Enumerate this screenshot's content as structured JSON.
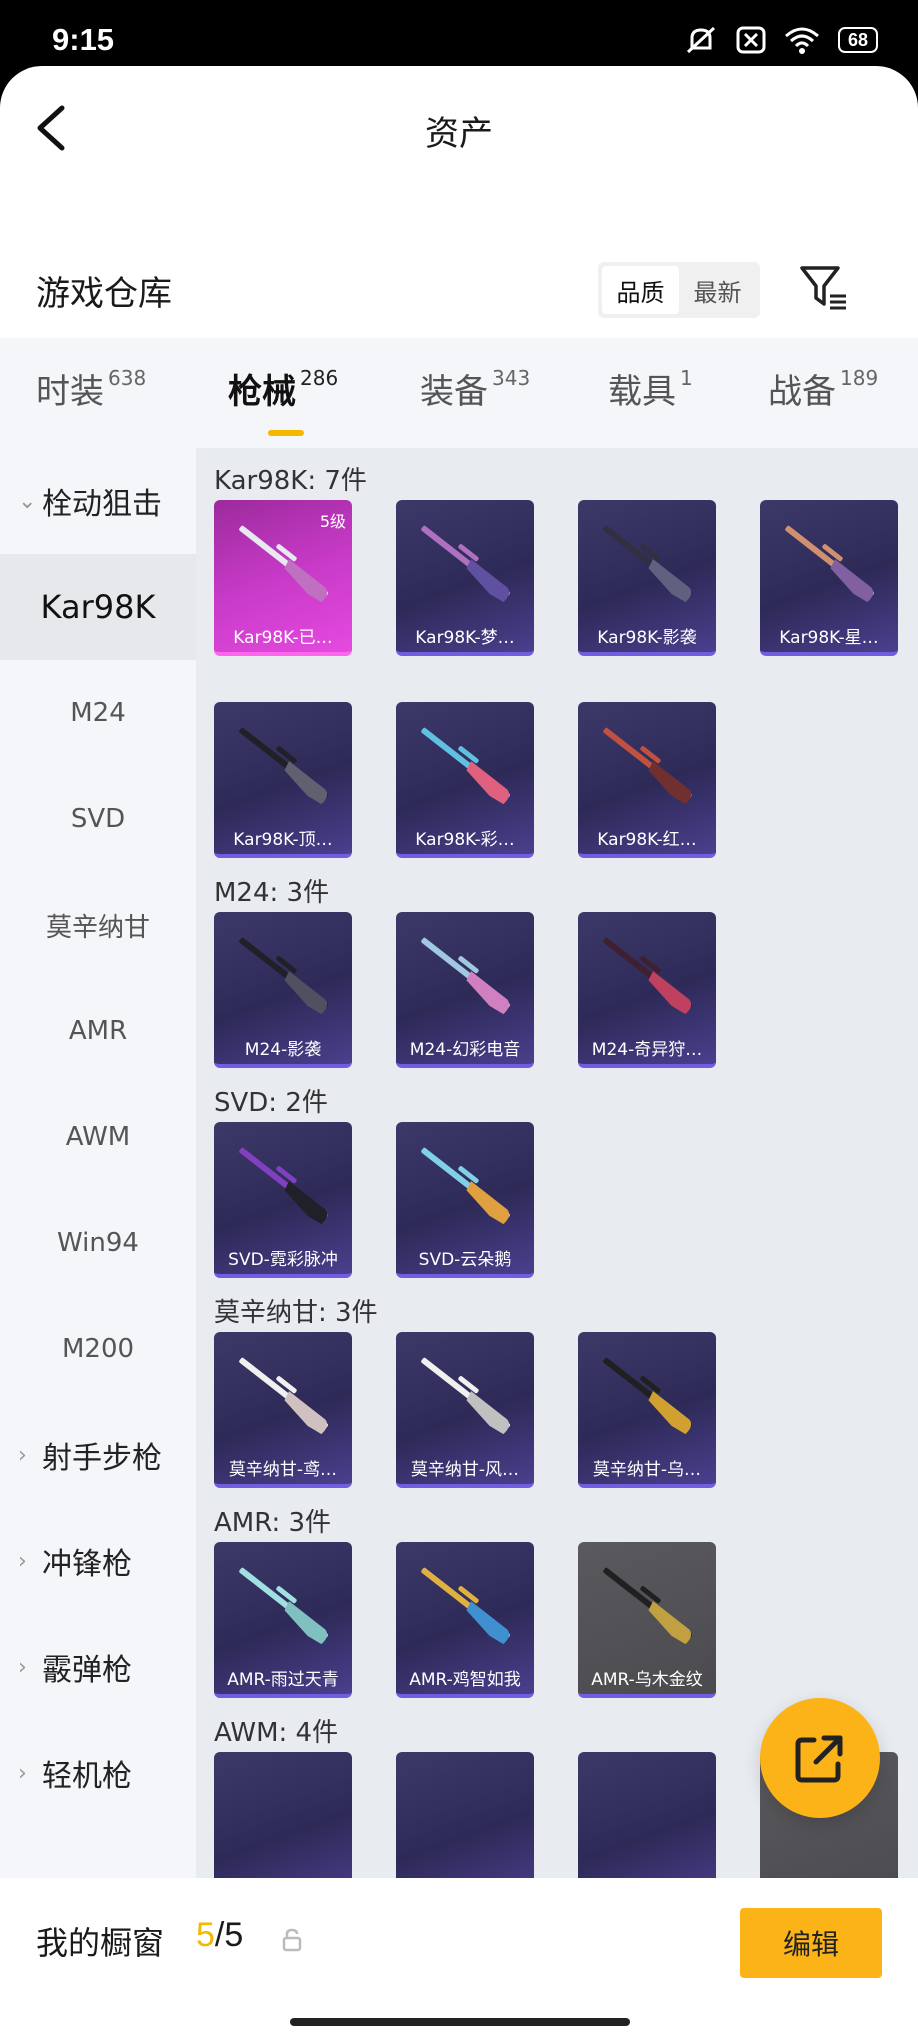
{
  "status": {
    "time": "9:15",
    "battery": "68"
  },
  "header": {
    "title": "资产"
  },
  "warehouse": {
    "title": "游戏仓库",
    "sort_quality": "品质",
    "sort_newest": "最新"
  },
  "tabs": [
    {
      "label": "时装",
      "count": "638"
    },
    {
      "label": "枪械",
      "count": "286"
    },
    {
      "label": "装备",
      "count": "343"
    },
    {
      "label": "载具",
      "count": "1"
    },
    {
      "label": "战备",
      "count": "189"
    }
  ],
  "sidebar": {
    "group_bolt": "栓动狙击",
    "items": [
      "Kar98K",
      "M24",
      "SVD",
      "莫辛纳甘",
      "AMR",
      "AWM",
      "Win94",
      "M200"
    ],
    "groups": [
      "射手步枪",
      "冲锋枪",
      "霰弹枪",
      "轻机枪"
    ]
  },
  "sections": [
    {
      "title": "Kar98K: 7件",
      "items": [
        "Kar98K-已…",
        "Kar98K-梦…",
        "Kar98K-影袭",
        "Kar98K-星…",
        "Kar98K-顶…",
        "Kar98K-彩…",
        "Kar98K-红…"
      ],
      "first_level": "5级"
    },
    {
      "title": "M24: 3件",
      "items": [
        "M24-影袭",
        "M24-幻彩电音",
        "M24-奇异狩…"
      ]
    },
    {
      "title": "SVD: 2件",
      "items": [
        "SVD-霓彩脉冲",
        "SVD-云朵鹅"
      ]
    },
    {
      "title": "莫辛纳甘: 3件",
      "items": [
        "莫辛纳甘-鸢…",
        "莫辛纳甘-风…",
        "莫辛纳甘-乌…"
      ]
    },
    {
      "title": "AMR: 3件",
      "items": [
        "AMR-雨过天青",
        "AMR-鸡智如我",
        "AMR-乌木金纹"
      ]
    },
    {
      "title": "AWM: 4件",
      "items": []
    }
  ],
  "showcase": {
    "label": "我的橱窗",
    "current": "5",
    "total": "/5",
    "edit_label": "编辑"
  },
  "colors": {
    "accent": "#fbb318",
    "card_purple": "#2e2a58",
    "card_pink": "#c73ac7"
  },
  "icons": [
    "back-icon",
    "filter-icon",
    "share-icon",
    "lock-icon"
  ]
}
